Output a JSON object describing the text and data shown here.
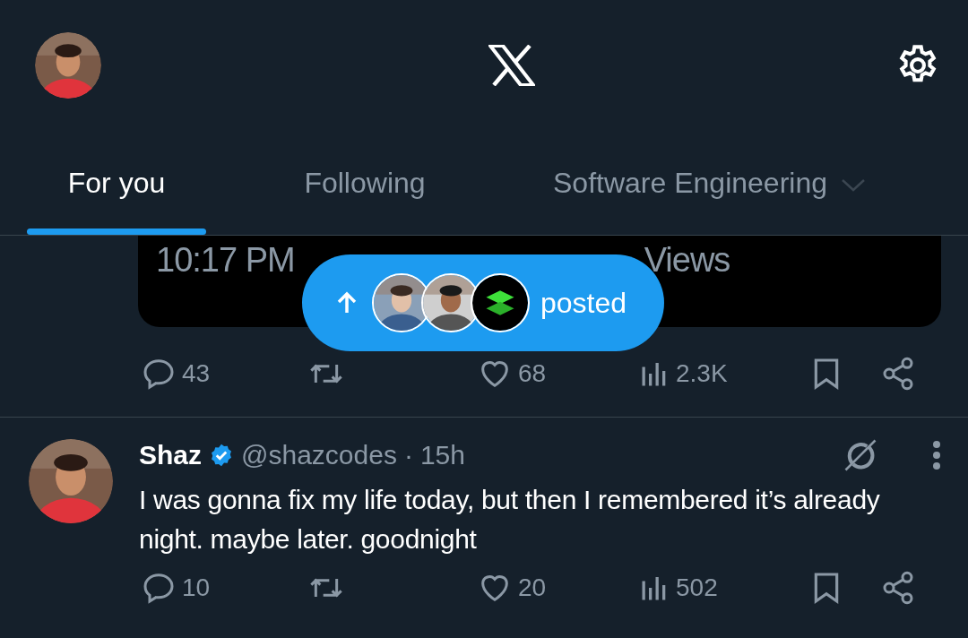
{
  "tabs": [
    {
      "label": "For you",
      "selected": true,
      "dropdown": false
    },
    {
      "label": "Following",
      "selected": false,
      "dropdown": false
    },
    {
      "label": "Software Engineering",
      "selected": false,
      "dropdown": true
    }
  ],
  "previous_post": {
    "time": "10:17 PM",
    "views_label": "Views",
    "actions": [
      {
        "kind": "reply",
        "count": "43"
      },
      {
        "kind": "repost"
      },
      {
        "kind": "like",
        "count": "68"
      },
      {
        "kind": "views",
        "count": "2.3K"
      },
      {
        "kind": "bookmark"
      },
      {
        "kind": "share"
      }
    ]
  },
  "new_posts_pill": {
    "label": "posted"
  },
  "tweet": {
    "name": "Shaz",
    "verified": true,
    "handle": "@shazcodes",
    "separator": "·",
    "time": "15h",
    "text": "I was gonna fix my life today, but then I remembered it’s already night. maybe later. goodnight",
    "actions": [
      {
        "kind": "reply",
        "count": "10"
      },
      {
        "kind": "repost"
      },
      {
        "kind": "like",
        "count": "20"
      },
      {
        "kind": "views",
        "count": "502"
      },
      {
        "kind": "bookmark"
      },
      {
        "kind": "share"
      }
    ]
  }
}
